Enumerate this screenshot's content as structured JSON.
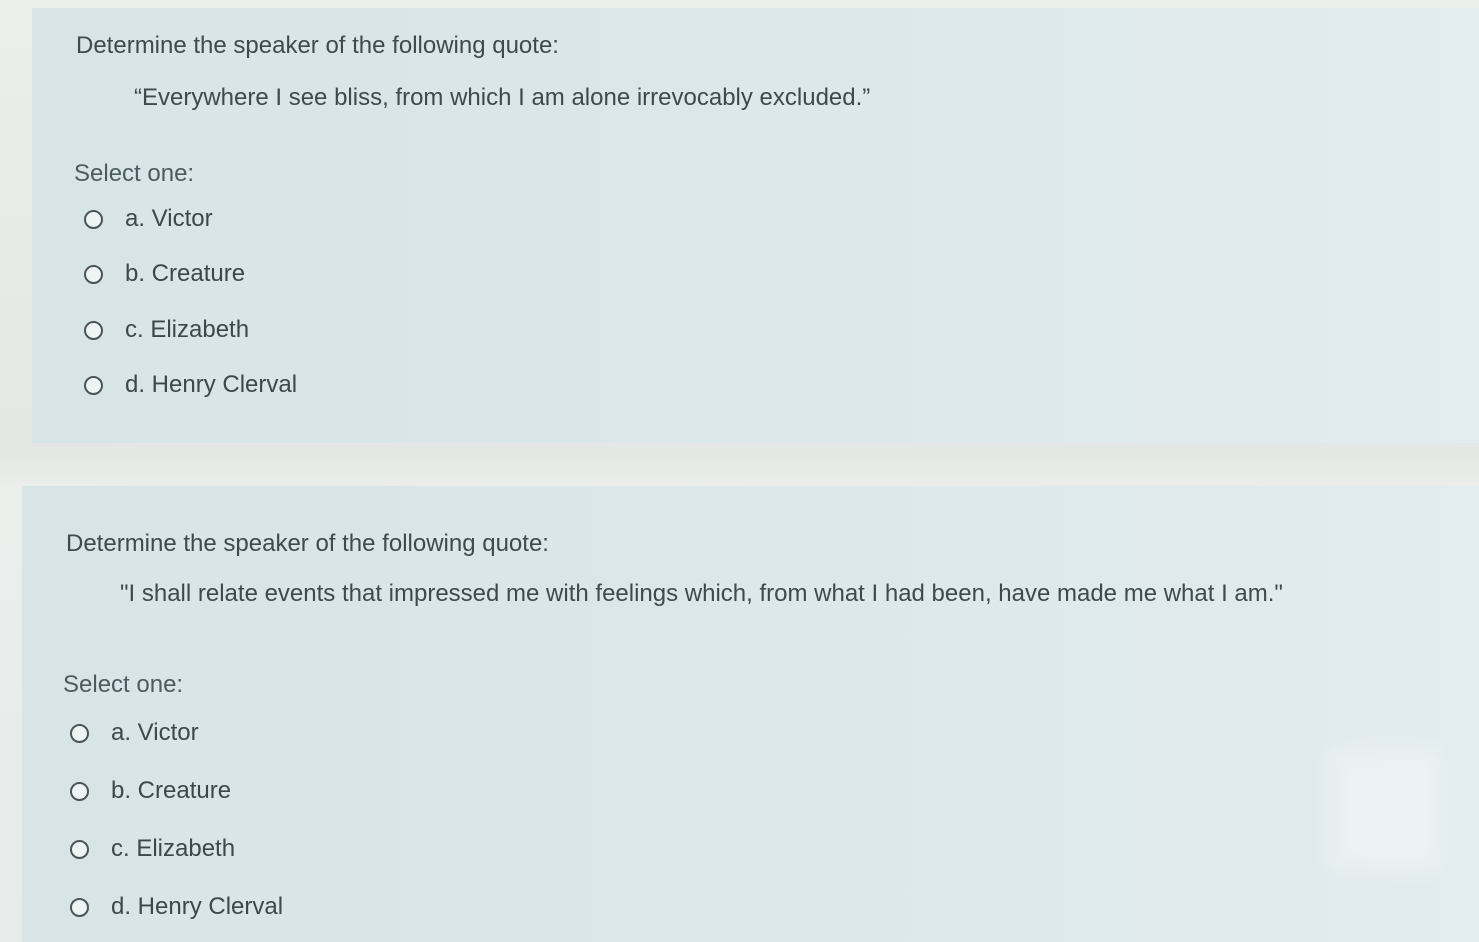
{
  "questions": [
    {
      "prompt": "Determine the speaker of the following quote:",
      "quote": "“Everywhere I see bliss, from which I am alone irrevocably excluded.”",
      "select_label": "Select one:",
      "options": [
        {
          "label": "a. Victor",
          "selected": false
        },
        {
          "label": "b. Creature",
          "selected": false
        },
        {
          "label": "c. Elizabeth",
          "selected": false
        },
        {
          "label": "d. Henry Clerval",
          "selected": false
        }
      ]
    },
    {
      "prompt": "Determine the speaker of the following quote:",
      "quote": "\"I shall relate events that impressed me with feelings which, from what I had been, have made me what I am.\"",
      "select_label": "Select one:",
      "options": [
        {
          "label": "a. Victor",
          "selected": false
        },
        {
          "label": "b. Creature",
          "selected": false
        },
        {
          "label": "c. Elizabeth",
          "selected": false
        },
        {
          "label": "d. Henry Clerval",
          "selected": false
        }
      ]
    }
  ]
}
